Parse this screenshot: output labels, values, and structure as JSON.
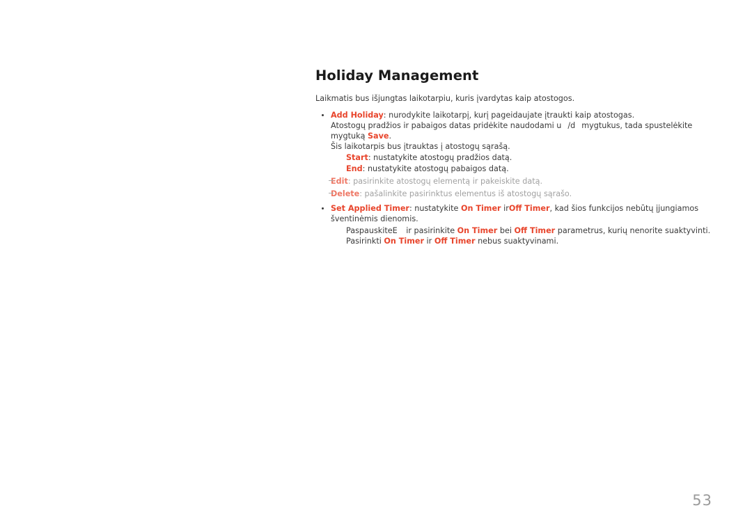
{
  "page": {
    "title": "Holiday Management",
    "intro": "Laikmatis bus išjungtas laikotarpiu, kuris įvardytas kaip atostogos.",
    "number": "53"
  },
  "colors": {
    "accent": "#e8452c",
    "body_text": "#3a3a3a",
    "muted_text": "#7d7d7d",
    "page_number": "#9a9a9a",
    "background": "#ffffff"
  },
  "sections": {
    "add_holiday": {
      "term": "Add Holiday",
      "description": ": nurodykite laikotarpį, kurį pageidaujate įtraukti kaip atostogas.",
      "line2_prefix": "Atostogų pradžios ir pabaigos datas pridėkite naudodami ",
      "line2_glyph_a": "u",
      "line2_sep": "/",
      "line2_glyph_b": "d",
      "line2_middle": "mygtukus, tada spustelėkite mygtuką ",
      "line2_accent": "Save",
      "line2_suffix": ".",
      "line3": "Šis laikotarpis bus įtrauktas į atostogų sąrašą.",
      "sub_items": [
        {
          "term": "Start",
          "description": ": nustatykite atostogų pradžios datą."
        },
        {
          "term": "End",
          "description": ": nustatykite atostogų pabaigos datą."
        }
      ]
    },
    "dash_items": [
      {
        "term": "Edit",
        "description": ": pasirinkite atostogų elementą ir pakeiskite datą."
      },
      {
        "term": "Delete",
        "description": ": pašalinkite pasirinktus elementus iš atostogų sąrašo."
      }
    ],
    "set_applied_timer": {
      "term": "Set Applied Timer",
      "desc_a": ": nustatykite ",
      "accent_on": "On Timer",
      "desc_b": " ir",
      "accent_off": "Off Timer",
      "desc_c": ", kad šios funkcijos nebūtų įjungiamos šventinėmis dienomis.",
      "sub_line_1": {
        "prefix": "PaspauskiteE",
        "middle_a": " ir pasirinkite ",
        "accent_on": "On Timer",
        "middle_b": " bei ",
        "accent_off": "Off Timer",
        "suffix": " parametrus, kurių nenorite suaktyvinti."
      },
      "sub_line_2": {
        "prefix": "Pasirinkti ",
        "accent_on": "On Timer",
        "middle": " ir ",
        "accent_off": "Off Timer",
        "suffix": " nebus suaktyvinami."
      }
    }
  }
}
